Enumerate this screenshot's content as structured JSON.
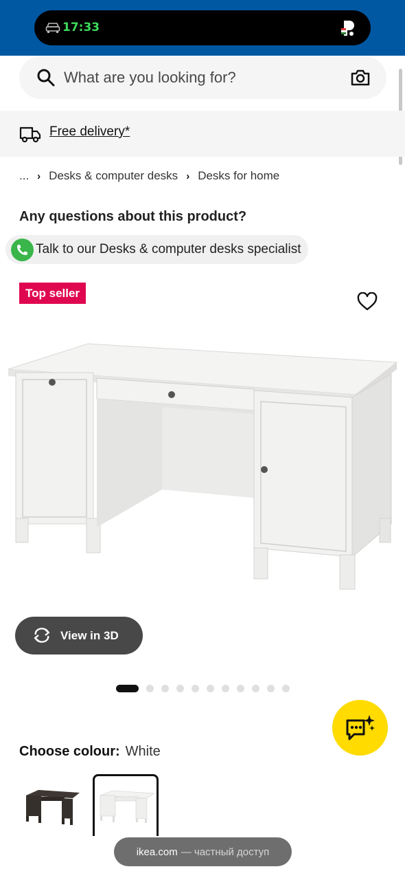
{
  "status_bar": {
    "time": "17:33",
    "left_icon": "car-icon",
    "right_icon": "pinned-app-icon",
    "accent_color": "#3ddc5c",
    "background": "#0058a3"
  },
  "search": {
    "placeholder": "What are you looking for?",
    "icons": [
      "search-icon",
      "camera-icon"
    ]
  },
  "delivery": {
    "label": "Free delivery*",
    "icon": "truck-icon"
  },
  "breadcrumb": {
    "items": [
      "...",
      "Desks & computer desks",
      "Desks for home"
    ]
  },
  "questions": {
    "title": "Any questions about this product?",
    "specialist_label": "Talk to our Desks & computer desks specialist",
    "icon": "phone-icon"
  },
  "product": {
    "badge": "Top seller",
    "badge_color": "#e00751",
    "favorite_icon": "heart-icon",
    "image": "white-desk-photo"
  },
  "view_3d": {
    "label": "View in 3D",
    "icon": "rotate-3d-icon"
  },
  "carousel": {
    "active_index": 0,
    "total": 12
  },
  "assistant_fab": {
    "icon": "ai-chat-icon",
    "color": "#ffdb00"
  },
  "colour": {
    "label": "Choose colour:",
    "selected": "White",
    "swatches": [
      "Black-brown",
      "White"
    ]
  },
  "url_bar": {
    "domain": "ikea.com",
    "suffix": "— частный доступ"
  }
}
